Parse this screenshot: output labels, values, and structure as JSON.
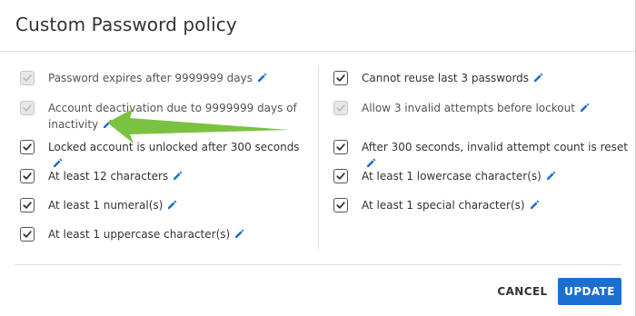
{
  "dialog": {
    "title": "Custom Password policy"
  },
  "left_options": [
    {
      "label": "Password expires after 9999999 days",
      "checked": true,
      "disabled": true
    },
    {
      "label": "Account deactivation due to 9999999 days of inactivity",
      "checked": true,
      "disabled": true
    },
    {
      "label": "Locked account is unlocked after 300 seconds",
      "checked": true,
      "disabled": false
    },
    {
      "label": "At least 12 characters",
      "checked": true,
      "disabled": false
    },
    {
      "label": "At least 1 numeral(s)",
      "checked": true,
      "disabled": false
    },
    {
      "label": "At least 1 uppercase character(s)",
      "checked": true,
      "disabled": false
    }
  ],
  "right_options": [
    {
      "label": "Cannot reuse last 3 passwords",
      "checked": true,
      "disabled": false
    },
    {
      "label": "Allow 3 invalid attempts before lockout",
      "checked": true,
      "disabled": true
    },
    {
      "label": "After 300 seconds, invalid attempt count is reset",
      "checked": true,
      "disabled": false
    },
    {
      "label": "At least 1 lowercase character(s)",
      "checked": true,
      "disabled": false
    },
    {
      "label": "At least 1 special character(s)",
      "checked": true,
      "disabled": false
    }
  ],
  "buttons": {
    "cancel": "CANCEL",
    "update": "UPDATE"
  },
  "icons": {
    "edit": "pencil-icon",
    "check": "checkmark-icon",
    "annotation": "green-arrow"
  },
  "colors": {
    "accent": "#1b6fd1",
    "annotation_arrow": "#7cc242"
  }
}
